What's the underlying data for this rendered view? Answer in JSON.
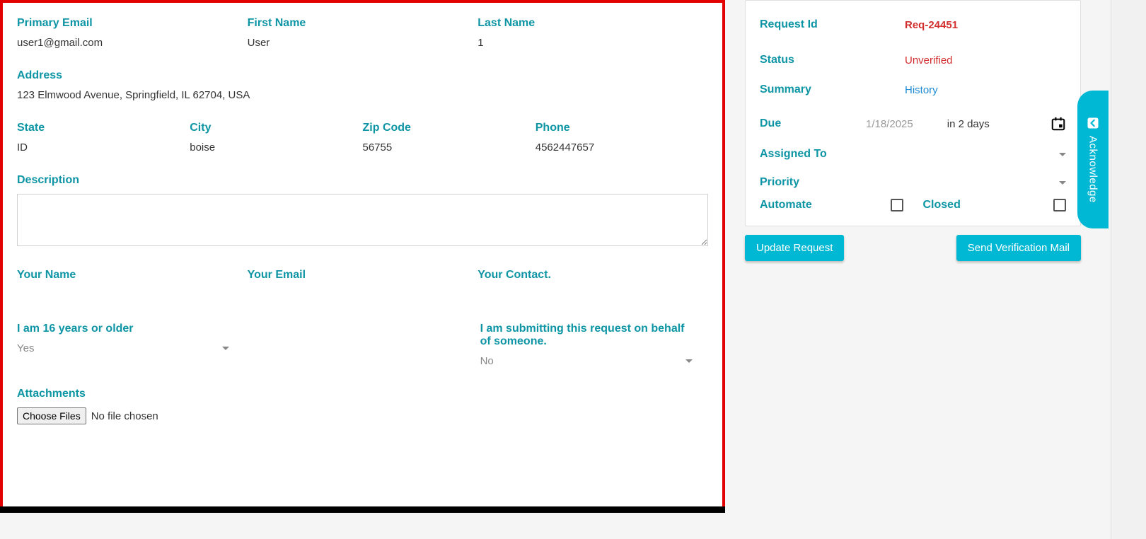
{
  "form": {
    "primary_email": {
      "label": "Primary Email",
      "value": "user1@gmail.com"
    },
    "first_name": {
      "label": "First Name",
      "value": "User"
    },
    "last_name": {
      "label": "Last Name",
      "value": "1"
    },
    "address": {
      "label": "Address",
      "value": "123 Elmwood Avenue, Springfield, IL 62704, USA"
    },
    "state": {
      "label": "State",
      "value": "ID"
    },
    "city": {
      "label": "City",
      "value": "boise"
    },
    "zip": {
      "label": "Zip Code",
      "value": "56755"
    },
    "phone": {
      "label": "Phone",
      "value": "4562447657"
    },
    "description": {
      "label": "Description",
      "value": ""
    },
    "your_name": {
      "label": "Your Name",
      "value": ""
    },
    "your_email": {
      "label": "Your Email",
      "value": ""
    },
    "your_contact": {
      "label": "Your Contact.",
      "value": ""
    },
    "age_confirm": {
      "label": "I am 16 years or older",
      "value": "Yes"
    },
    "on_behalf": {
      "label": "I am submitting this request on behalf of someone.",
      "value": "No"
    },
    "attachments": {
      "label": "Attachments",
      "button": "Choose Files",
      "status": "No file chosen"
    }
  },
  "sidebar": {
    "request_id": {
      "label": "Request Id",
      "value": "Req-24451"
    },
    "status": {
      "label": "Status",
      "value": "Unverified"
    },
    "summary": {
      "label": "Summary",
      "value": "History"
    },
    "due": {
      "label": "Due",
      "date": "1/18/2025",
      "relative": "in 2 days"
    },
    "assigned_to": {
      "label": "Assigned To",
      "value": ""
    },
    "priority": {
      "label": "Priority",
      "value": ""
    },
    "automate": {
      "label": "Automate",
      "checked": false
    },
    "closed": {
      "label": "Closed",
      "checked": false
    }
  },
  "actions": {
    "update": "Update Request",
    "verify": "Send Verification Mail"
  },
  "ack_tab": "Acknowledge"
}
